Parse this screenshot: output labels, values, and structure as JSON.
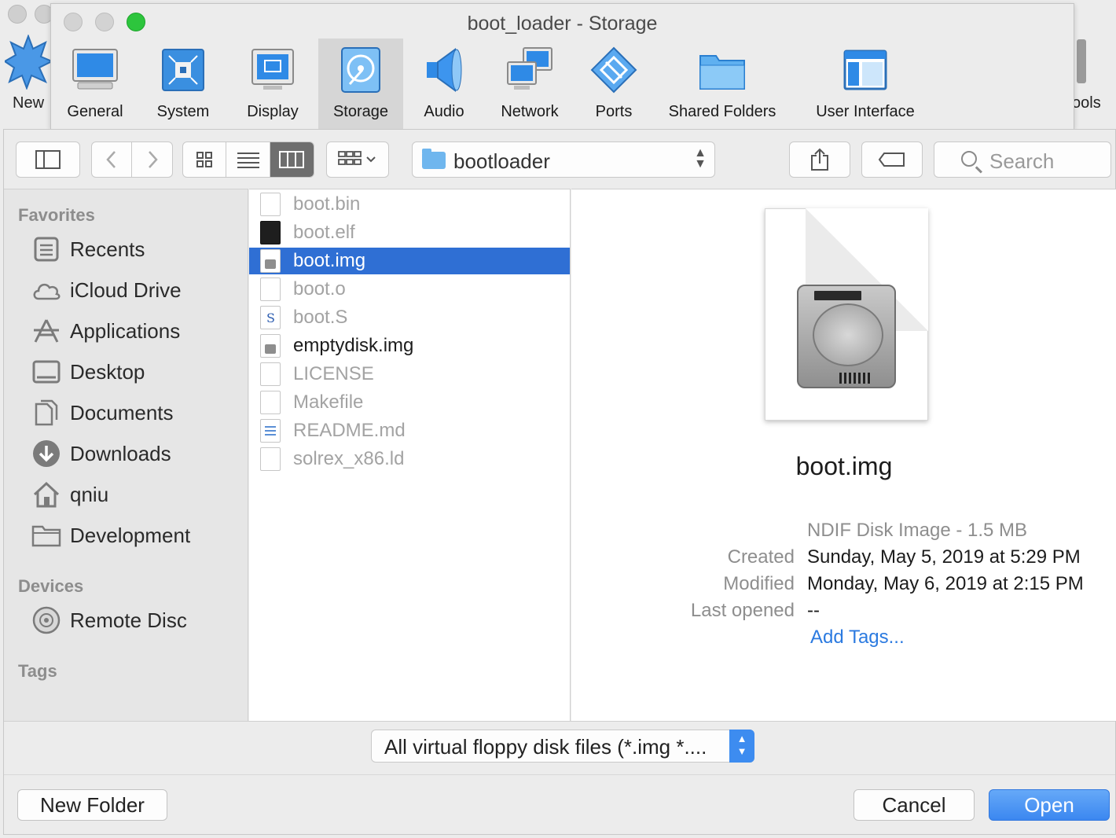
{
  "background_window": {
    "new_label": "New",
    "tools_label": "ools"
  },
  "settings_window": {
    "title": "boot_loader - Storage",
    "tabs": [
      {
        "label": "General",
        "icon": "monitor-icon"
      },
      {
        "label": "System",
        "icon": "chip-icon"
      },
      {
        "label": "Display",
        "icon": "display-icon"
      },
      {
        "label": "Storage",
        "icon": "storage-icon",
        "active": true
      },
      {
        "label": "Audio",
        "icon": "speaker-icon"
      },
      {
        "label": "Network",
        "icon": "network-icon"
      },
      {
        "label": "Ports",
        "icon": "ports-icon"
      },
      {
        "label": "Shared Folders",
        "icon": "folder-icon"
      },
      {
        "label": "User Interface",
        "icon": "window-icon"
      }
    ]
  },
  "toolbar": {
    "path": "bootloader",
    "search_placeholder": "Search"
  },
  "sidebar": {
    "favorites_heading": "Favorites",
    "favorites": [
      {
        "label": "Recents",
        "icon": "recents-icon"
      },
      {
        "label": "iCloud Drive",
        "icon": "cloud-icon"
      },
      {
        "label": "Applications",
        "icon": "applications-icon"
      },
      {
        "label": "Desktop",
        "icon": "desktop-icon"
      },
      {
        "label": "Documents",
        "icon": "documents-icon"
      },
      {
        "label": "Downloads",
        "icon": "downloads-icon"
      },
      {
        "label": "qniu",
        "icon": "home-icon"
      },
      {
        "label": "Development",
        "icon": "folder-icon"
      }
    ],
    "devices_heading": "Devices",
    "devices": [
      {
        "label": "Remote Disc",
        "icon": "disc-icon"
      }
    ],
    "tags_heading": "Tags"
  },
  "files": [
    {
      "name": "boot.bin",
      "state": "dim"
    },
    {
      "name": "boot.elf",
      "state": "dim"
    },
    {
      "name": "boot.img",
      "state": "selected"
    },
    {
      "name": "boot.o",
      "state": "dim"
    },
    {
      "name": "boot.S",
      "state": "dim"
    },
    {
      "name": "emptydisk.img",
      "state": "normal"
    },
    {
      "name": "LICENSE",
      "state": "dim"
    },
    {
      "name": "Makefile",
      "state": "dim"
    },
    {
      "name": "README.md",
      "state": "dim"
    },
    {
      "name": "solrex_x86.ld",
      "state": "dim"
    }
  ],
  "preview": {
    "name": "boot.img",
    "kind": "NDIF Disk Image - 1.5 MB",
    "created_label": "Created",
    "created": "Sunday, May 5, 2019 at 5:29 PM",
    "modified_label": "Modified",
    "modified": "Monday, May 6, 2019 at 2:15 PM",
    "opened_label": "Last opened",
    "opened": "--",
    "add_tags": "Add Tags..."
  },
  "filter": {
    "selected": "All virtual floppy disk files (*.img *...."
  },
  "buttons": {
    "new_folder": "New Folder",
    "cancel": "Cancel",
    "open": "Open"
  },
  "colors": {
    "selection": "#2f6fd4",
    "primary_button": "#3b87f0",
    "link": "#2b7ae0"
  }
}
